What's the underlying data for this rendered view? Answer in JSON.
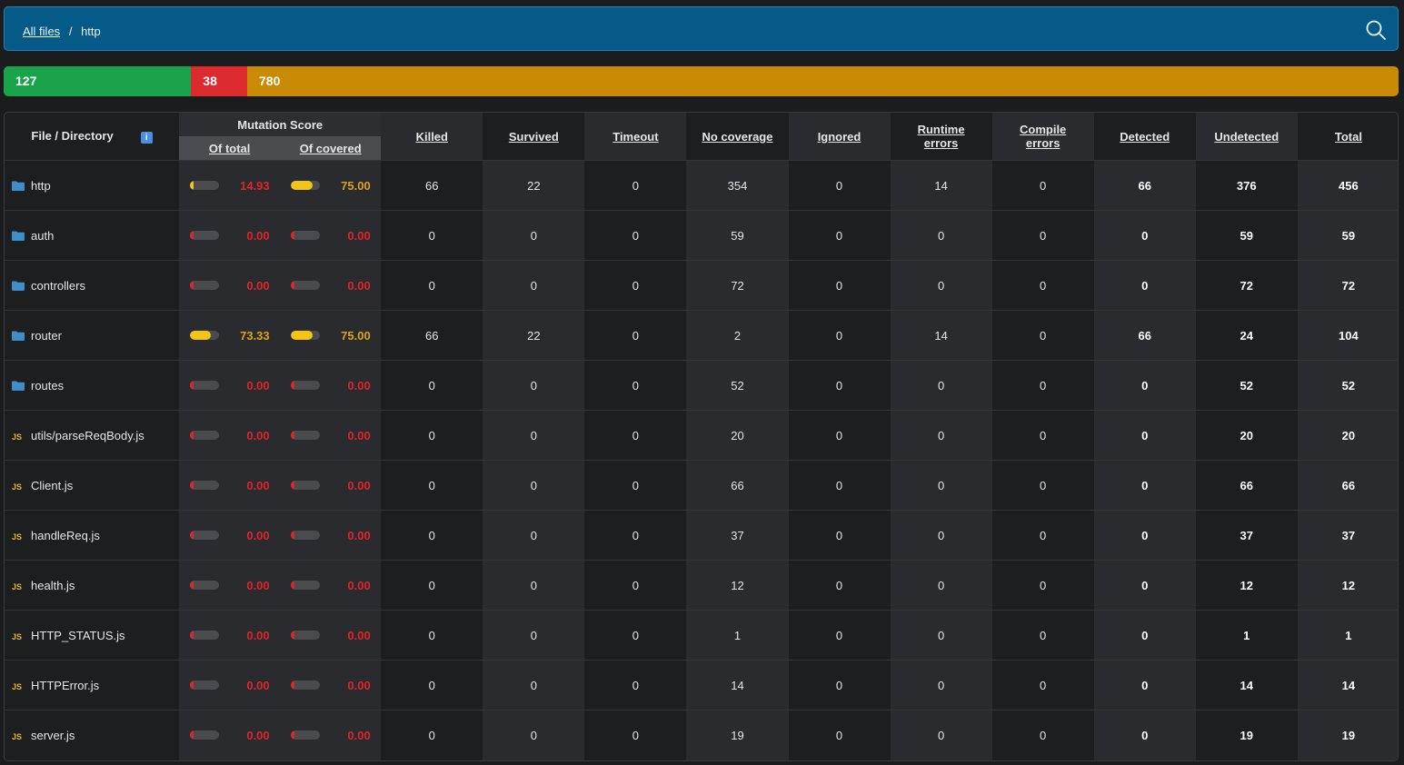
{
  "breadcrumb": {
    "root": "All files",
    "separator": "/",
    "current": "http"
  },
  "summary": {
    "killed": "127",
    "survived": "38",
    "no_coverage": "780",
    "killed_fraction": 0.1344,
    "survived_fraction": 0.0402,
    "no_coverage_fraction": 0.8254,
    "colors": {
      "killed": "#1aa34a",
      "survived": "#dd2a2f",
      "no_coverage": "#c98a04"
    }
  },
  "table": {
    "headers": {
      "file": "File / Directory",
      "mutation_score": "Mutation Score",
      "of_total": "Of total",
      "of_covered": "Of covered",
      "killed": "Killed",
      "survived": "Survived",
      "timeout": "Timeout",
      "no_coverage": "No coverage",
      "ignored": "Ignored",
      "runtime_errors_1": "Runtime",
      "runtime_errors_2": "errors",
      "compile_errors_1": "Compile",
      "compile_errors_2": "errors",
      "detected": "Detected",
      "undetected": "Undetected",
      "total": "Total"
    },
    "rows": [
      {
        "name": "http",
        "type": "folder",
        "of_total": "14.93",
        "of_covered": "75.00",
        "killed": "66",
        "survived": "22",
        "timeout": "0",
        "no_coverage": "354",
        "ignored": "0",
        "runtime": "14",
        "compile": "0",
        "detected": "66",
        "undetected": "376",
        "total": "456"
      },
      {
        "name": "auth",
        "type": "folder",
        "of_total": "0.00",
        "of_covered": "0.00",
        "killed": "0",
        "survived": "0",
        "timeout": "0",
        "no_coverage": "59",
        "ignored": "0",
        "runtime": "0",
        "compile": "0",
        "detected": "0",
        "undetected": "59",
        "total": "59"
      },
      {
        "name": "controllers",
        "type": "folder",
        "of_total": "0.00",
        "of_covered": "0.00",
        "killed": "0",
        "survived": "0",
        "timeout": "0",
        "no_coverage": "72",
        "ignored": "0",
        "runtime": "0",
        "compile": "0",
        "detected": "0",
        "undetected": "72",
        "total": "72"
      },
      {
        "name": "router",
        "type": "folder",
        "of_total": "73.33",
        "of_covered": "75.00",
        "killed": "66",
        "survived": "22",
        "timeout": "0",
        "no_coverage": "2",
        "ignored": "0",
        "runtime": "14",
        "compile": "0",
        "detected": "66",
        "undetected": "24",
        "total": "104"
      },
      {
        "name": "routes",
        "type": "folder",
        "of_total": "0.00",
        "of_covered": "0.00",
        "killed": "0",
        "survived": "0",
        "timeout": "0",
        "no_coverage": "52",
        "ignored": "0",
        "runtime": "0",
        "compile": "0",
        "detected": "0",
        "undetected": "52",
        "total": "52"
      },
      {
        "name": "utils/parseReqBody.js",
        "type": "js",
        "of_total": "0.00",
        "of_covered": "0.00",
        "killed": "0",
        "survived": "0",
        "timeout": "0",
        "no_coverage": "20",
        "ignored": "0",
        "runtime": "0",
        "compile": "0",
        "detected": "0",
        "undetected": "20",
        "total": "20"
      },
      {
        "name": "Client.js",
        "type": "js",
        "of_total": "0.00",
        "of_covered": "0.00",
        "killed": "0",
        "survived": "0",
        "timeout": "0",
        "no_coverage": "66",
        "ignored": "0",
        "runtime": "0",
        "compile": "0",
        "detected": "0",
        "undetected": "66",
        "total": "66"
      },
      {
        "name": "handleReq.js",
        "type": "js",
        "of_total": "0.00",
        "of_covered": "0.00",
        "killed": "0",
        "survived": "0",
        "timeout": "0",
        "no_coverage": "37",
        "ignored": "0",
        "runtime": "0",
        "compile": "0",
        "detected": "0",
        "undetected": "37",
        "total": "37"
      },
      {
        "name": "health.js",
        "type": "js",
        "of_total": "0.00",
        "of_covered": "0.00",
        "killed": "0",
        "survived": "0",
        "timeout": "0",
        "no_coverage": "12",
        "ignored": "0",
        "runtime": "0",
        "compile": "0",
        "detected": "0",
        "undetected": "12",
        "total": "12"
      },
      {
        "name": "HTTP_STATUS.js",
        "type": "js",
        "of_total": "0.00",
        "of_covered": "0.00",
        "killed": "0",
        "survived": "0",
        "timeout": "0",
        "no_coverage": "1",
        "ignored": "0",
        "runtime": "0",
        "compile": "0",
        "detected": "0",
        "undetected": "1",
        "total": "1"
      },
      {
        "name": "HTTPError.js",
        "type": "js",
        "of_total": "0.00",
        "of_covered": "0.00",
        "killed": "0",
        "survived": "0",
        "timeout": "0",
        "no_coverage": "14",
        "ignored": "0",
        "runtime": "0",
        "compile": "0",
        "detected": "0",
        "undetected": "14",
        "total": "14"
      },
      {
        "name": "server.js",
        "type": "js",
        "of_total": "0.00",
        "of_covered": "0.00",
        "killed": "0",
        "survived": "0",
        "timeout": "0",
        "no_coverage": "19",
        "ignored": "0",
        "runtime": "0",
        "compile": "0",
        "detected": "0",
        "undetected": "19",
        "total": "19"
      }
    ]
  },
  "icons": {
    "folder": "folder-icon",
    "js": "js-file-icon",
    "search": "search-icon",
    "info": "info-icon"
  },
  "js_icon_label": "JS",
  "info_icon_label": "i",
  "colors": {
    "score_red": "#e0242b",
    "score_yellow": "#e0a21a",
    "bar_yellow": "#f2c518"
  }
}
